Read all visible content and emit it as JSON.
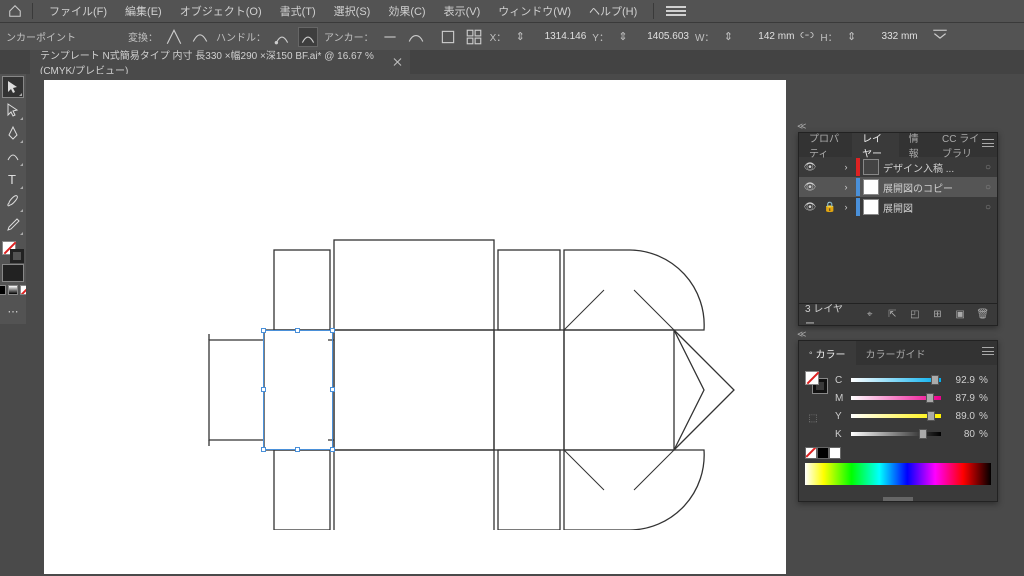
{
  "menu": {
    "file": "ファイル(F)",
    "edit": "編集(E)",
    "object": "オブジェクト(O)",
    "type": "書式(T)",
    "select": "選択(S)",
    "effect": "効果(C)",
    "view": "表示(V)",
    "window": "ウィンドウ(W)",
    "help": "ヘルプ(H)"
  },
  "ctrl": {
    "anchor_point_label": "ンカーポイント",
    "convert_label": "変換：",
    "handle_label": "ハンドル：",
    "anchor_label": "アンカー：",
    "x_label": "X：",
    "x_value": "1314.146",
    "y_label": "Y：",
    "y_value": "1405.603",
    "w_label": "W：",
    "w_value": "142 mm",
    "h_label": "H：",
    "h_value": "332 mm"
  },
  "doc": {
    "title": "テンプレート N式簡易タイプ 内寸 長330 ×幅290 ×深150 BF.ai* @ 16.67 % (CMYK/プレビュー)"
  },
  "layers": {
    "tabs": {
      "properties": "プロパティ",
      "layers": "レイヤー",
      "info": "情報",
      "cclib": "CC ライブラリ"
    },
    "items": [
      {
        "name": "デザイン入稿 ...",
        "color": "#d22",
        "selected": false,
        "locked": false,
        "dark": true
      },
      {
        "name": "展開図のコピー",
        "color": "#4a90d9",
        "selected": true,
        "locked": false,
        "dark": false
      },
      {
        "name": "展開図",
        "color": "#4a90d9",
        "selected": false,
        "locked": true,
        "dark": false
      }
    ],
    "footer_count": "3 レイヤー"
  },
  "color": {
    "tabs": {
      "color": "カラー",
      "guide": "カラーガイド"
    },
    "channels": [
      {
        "lab": "C",
        "val": "92.9",
        "grad": "linear-gradient(to right,#fff,#00aeef)",
        "pos": 93
      },
      {
        "lab": "M",
        "val": "87.9",
        "grad": "linear-gradient(to right,#fff,#ec008c)",
        "pos": 88
      },
      {
        "lab": "Y",
        "val": "89.0",
        "grad": "linear-gradient(to right,#fff,#fff200)",
        "pos": 89
      },
      {
        "lab": "K",
        "val": "80",
        "grad": "linear-gradient(to right,#fff,#000)",
        "pos": 80
      }
    ],
    "unit": "%"
  }
}
